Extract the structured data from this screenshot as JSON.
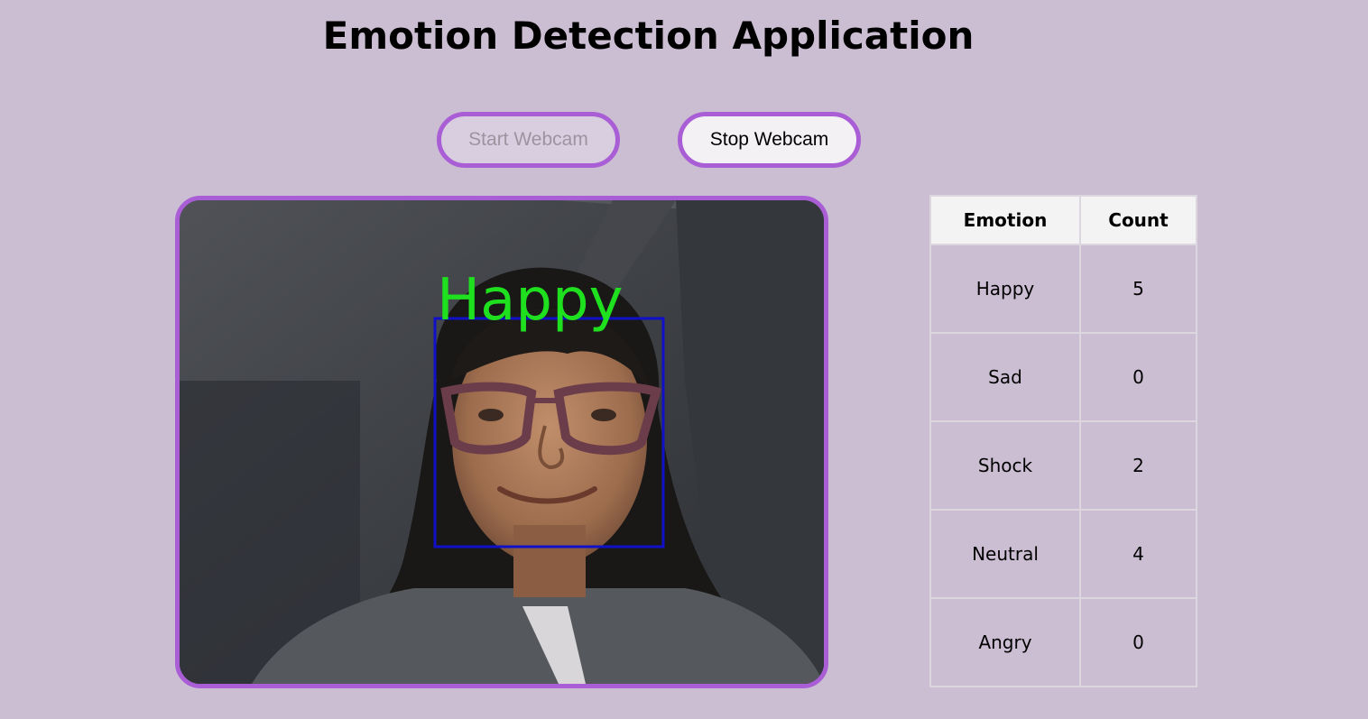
{
  "header": {
    "title": "Emotion Detection Application"
  },
  "controls": {
    "start_label": "Start Webcam",
    "stop_label": "Stop Webcam"
  },
  "video": {
    "detected_label": "Happy",
    "label_color": "#1fe01f",
    "box_color": "#1010c8"
  },
  "table": {
    "headers": [
      "Emotion",
      "Count"
    ],
    "rows": [
      {
        "emotion": "Happy",
        "count": "5"
      },
      {
        "emotion": "Sad",
        "count": "0"
      },
      {
        "emotion": "Shock",
        "count": "2"
      },
      {
        "emotion": "Neutral",
        "count": "4"
      },
      {
        "emotion": "Angry",
        "count": "0"
      }
    ]
  },
  "colors": {
    "background": "#cbbdd2",
    "accent": "#a95ed6"
  }
}
